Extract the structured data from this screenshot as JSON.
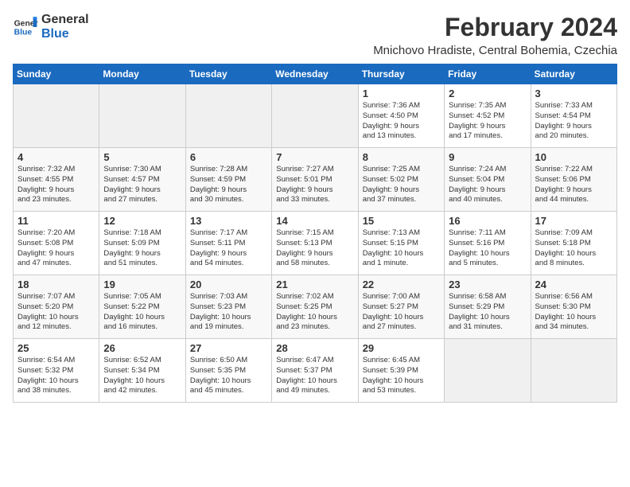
{
  "header": {
    "logo_line1": "General",
    "logo_line2": "Blue",
    "month_year": "February 2024",
    "location": "Mnichovo Hradiste, Central Bohemia, Czechia"
  },
  "weekdays": [
    "Sunday",
    "Monday",
    "Tuesday",
    "Wednesday",
    "Thursday",
    "Friday",
    "Saturday"
  ],
  "weeks": [
    [
      {
        "day": "",
        "text": ""
      },
      {
        "day": "",
        "text": ""
      },
      {
        "day": "",
        "text": ""
      },
      {
        "day": "",
        "text": ""
      },
      {
        "day": "1",
        "text": "Sunrise: 7:36 AM\nSunset: 4:50 PM\nDaylight: 9 hours\nand 13 minutes."
      },
      {
        "day": "2",
        "text": "Sunrise: 7:35 AM\nSunset: 4:52 PM\nDaylight: 9 hours\nand 17 minutes."
      },
      {
        "day": "3",
        "text": "Sunrise: 7:33 AM\nSunset: 4:54 PM\nDaylight: 9 hours\nand 20 minutes."
      }
    ],
    [
      {
        "day": "4",
        "text": "Sunrise: 7:32 AM\nSunset: 4:55 PM\nDaylight: 9 hours\nand 23 minutes."
      },
      {
        "day": "5",
        "text": "Sunrise: 7:30 AM\nSunset: 4:57 PM\nDaylight: 9 hours\nand 27 minutes."
      },
      {
        "day": "6",
        "text": "Sunrise: 7:28 AM\nSunset: 4:59 PM\nDaylight: 9 hours\nand 30 minutes."
      },
      {
        "day": "7",
        "text": "Sunrise: 7:27 AM\nSunset: 5:01 PM\nDaylight: 9 hours\nand 33 minutes."
      },
      {
        "day": "8",
        "text": "Sunrise: 7:25 AM\nSunset: 5:02 PM\nDaylight: 9 hours\nand 37 minutes."
      },
      {
        "day": "9",
        "text": "Sunrise: 7:24 AM\nSunset: 5:04 PM\nDaylight: 9 hours\nand 40 minutes."
      },
      {
        "day": "10",
        "text": "Sunrise: 7:22 AM\nSunset: 5:06 PM\nDaylight: 9 hours\nand 44 minutes."
      }
    ],
    [
      {
        "day": "11",
        "text": "Sunrise: 7:20 AM\nSunset: 5:08 PM\nDaylight: 9 hours\nand 47 minutes."
      },
      {
        "day": "12",
        "text": "Sunrise: 7:18 AM\nSunset: 5:09 PM\nDaylight: 9 hours\nand 51 minutes."
      },
      {
        "day": "13",
        "text": "Sunrise: 7:17 AM\nSunset: 5:11 PM\nDaylight: 9 hours\nand 54 minutes."
      },
      {
        "day": "14",
        "text": "Sunrise: 7:15 AM\nSunset: 5:13 PM\nDaylight: 9 hours\nand 58 minutes."
      },
      {
        "day": "15",
        "text": "Sunrise: 7:13 AM\nSunset: 5:15 PM\nDaylight: 10 hours\nand 1 minute."
      },
      {
        "day": "16",
        "text": "Sunrise: 7:11 AM\nSunset: 5:16 PM\nDaylight: 10 hours\nand 5 minutes."
      },
      {
        "day": "17",
        "text": "Sunrise: 7:09 AM\nSunset: 5:18 PM\nDaylight: 10 hours\nand 8 minutes."
      }
    ],
    [
      {
        "day": "18",
        "text": "Sunrise: 7:07 AM\nSunset: 5:20 PM\nDaylight: 10 hours\nand 12 minutes."
      },
      {
        "day": "19",
        "text": "Sunrise: 7:05 AM\nSunset: 5:22 PM\nDaylight: 10 hours\nand 16 minutes."
      },
      {
        "day": "20",
        "text": "Sunrise: 7:03 AM\nSunset: 5:23 PM\nDaylight: 10 hours\nand 19 minutes."
      },
      {
        "day": "21",
        "text": "Sunrise: 7:02 AM\nSunset: 5:25 PM\nDaylight: 10 hours\nand 23 minutes."
      },
      {
        "day": "22",
        "text": "Sunrise: 7:00 AM\nSunset: 5:27 PM\nDaylight: 10 hours\nand 27 minutes."
      },
      {
        "day": "23",
        "text": "Sunrise: 6:58 AM\nSunset: 5:29 PM\nDaylight: 10 hours\nand 31 minutes."
      },
      {
        "day": "24",
        "text": "Sunrise: 6:56 AM\nSunset: 5:30 PM\nDaylight: 10 hours\nand 34 minutes."
      }
    ],
    [
      {
        "day": "25",
        "text": "Sunrise: 6:54 AM\nSunset: 5:32 PM\nDaylight: 10 hours\nand 38 minutes."
      },
      {
        "day": "26",
        "text": "Sunrise: 6:52 AM\nSunset: 5:34 PM\nDaylight: 10 hours\nand 42 minutes."
      },
      {
        "day": "27",
        "text": "Sunrise: 6:50 AM\nSunset: 5:35 PM\nDaylight: 10 hours\nand 45 minutes."
      },
      {
        "day": "28",
        "text": "Sunrise: 6:47 AM\nSunset: 5:37 PM\nDaylight: 10 hours\nand 49 minutes."
      },
      {
        "day": "29",
        "text": "Sunrise: 6:45 AM\nSunset: 5:39 PM\nDaylight: 10 hours\nand 53 minutes."
      },
      {
        "day": "",
        "text": ""
      },
      {
        "day": "",
        "text": ""
      }
    ]
  ]
}
